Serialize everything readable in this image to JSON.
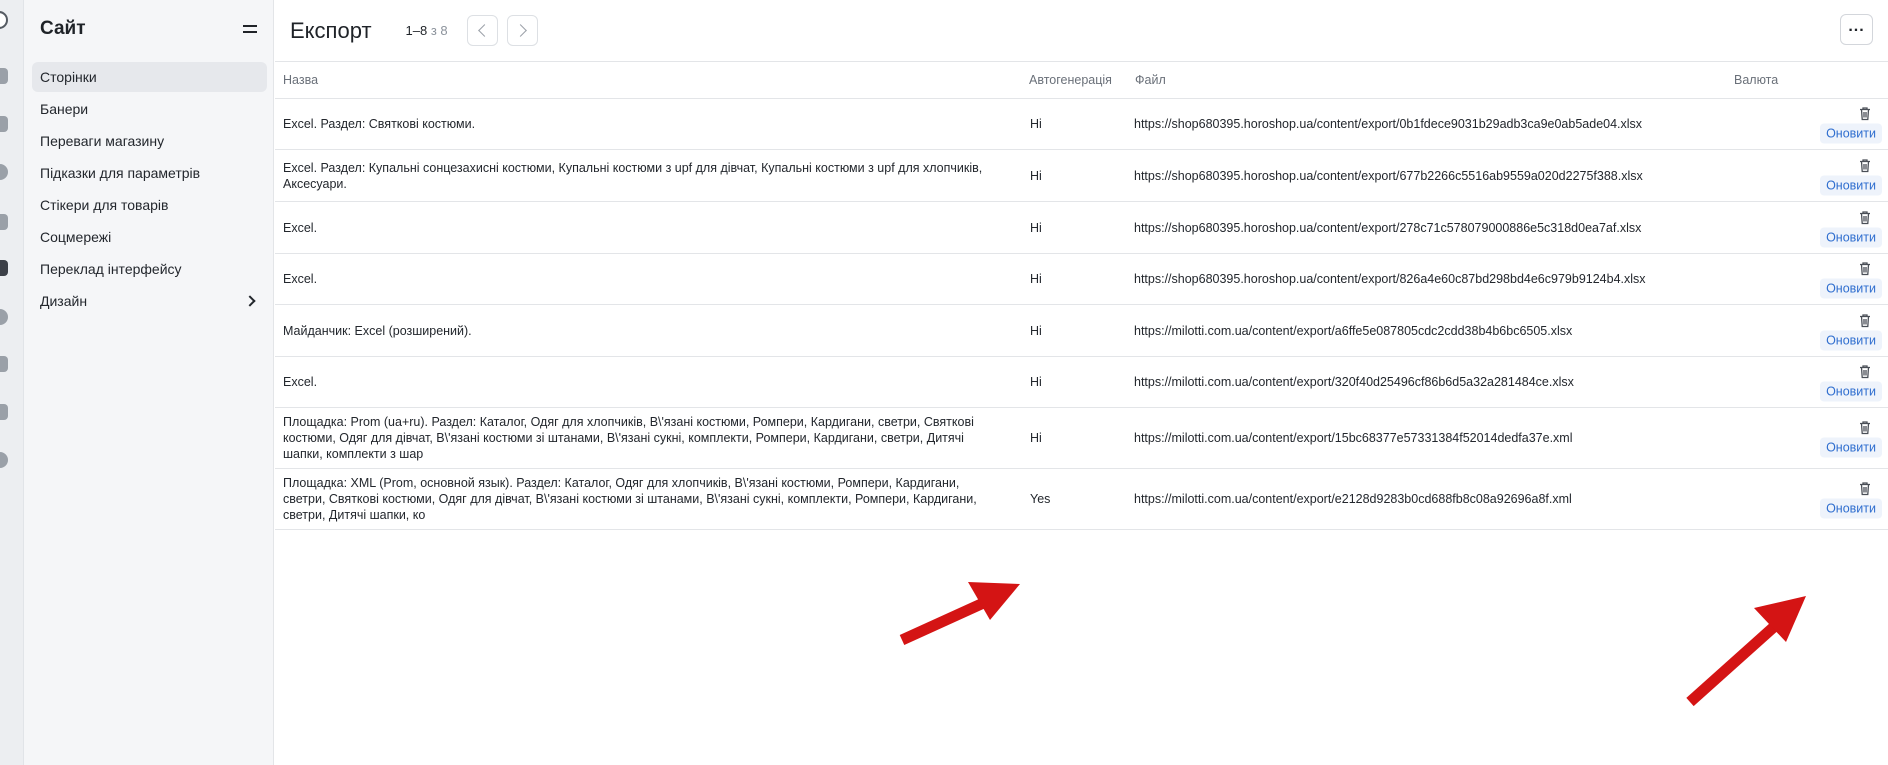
{
  "sidebar": {
    "title": "Сайт",
    "items": [
      {
        "label": "Сторінки",
        "active": true
      },
      {
        "label": "Банери"
      },
      {
        "label": "Переваги магазину"
      },
      {
        "label": "Підказки для параметрів"
      },
      {
        "label": "Стікери для товарів"
      },
      {
        "label": "Соцмережі"
      },
      {
        "label": "Переклад інтерфейсу"
      },
      {
        "label": "Дизайн",
        "has_submenu": true
      }
    ]
  },
  "header": {
    "title": "Експорт",
    "pager_range": "1–8",
    "pager_of": "з 8"
  },
  "table": {
    "columns": [
      "Назва",
      "Автогенерація",
      "Файл",
      "Валюта"
    ],
    "rows": [
      {
        "name": "Excel. Раздел: Святкові костюми.",
        "auto": "Ні",
        "file": "https://shop680395.horoshop.ua/content/export/0b1fdece9031b29adb3ca9e0ab5ade04.xlsx",
        "action": "Оновити"
      },
      {
        "name": "Excel. Раздел: Купальні сонцезахисні костюми, Купальні костюми з upf для дівчат, Купальні костюми з upf для хлопчиків, Аксесуари.",
        "auto": "Ні",
        "file": "https://shop680395.horoshop.ua/content/export/677b2266c5516ab9559a020d2275f388.xlsx",
        "action": "Оновити"
      },
      {
        "name": "Excel.",
        "auto": "Ні",
        "file": "https://shop680395.horoshop.ua/content/export/278c71c578079000886e5c318d0ea7af.xlsx",
        "action": "Оновити"
      },
      {
        "name": "Excel.",
        "auto": "Ні",
        "file": "https://shop680395.horoshop.ua/content/export/826a4e60c87bd298bd4e6c979b9124b4.xlsx",
        "action": "Оновити"
      },
      {
        "name": "Майданчик: Excel (розширений).",
        "auto": "Ні",
        "file": "https://milotti.com.ua/content/export/a6ffe5e087805cdc2cdd38b4b6bc6505.xlsx",
        "action": "Оновити"
      },
      {
        "name": "Excel.",
        "auto": "Ні",
        "file": "https://milotti.com.ua/content/export/320f40d25496cf86b6d5a32a281484ce.xlsx",
        "action": "Оновити"
      },
      {
        "name": "Площадка: Prom (ua+ru). Раздел: Каталог, Одяг для хлопчиків, В\\'язані костюми, Ромпери, Кардигани, светри, Святкові костюми, Одяг для дівчат, В\\'язані костюми зі штанами, В\\'язані сукні, комплекти, Ромпери, Кардигани, светри, Дитячі шапки, комплекти з шар",
        "auto": "Ні",
        "file": "https://milotti.com.ua/content/export/15bc68377e57331384f52014dedfa37e.xml",
        "action": "Оновити"
      },
      {
        "name": "Площадка: XML (Prom, основной язык). Раздел: Каталог, Одяг для хлопчиків, В\\'язані костюми, Ромпери, Кардигани, светри, Святкові костюми, Одяг для дівчат, В\\'язані костюми зі штанами, В\\'язані сукні, комплекти, Ромпери, Кардигани, светри, Дитячі шапки, ко",
        "auto": "Yes",
        "file": "https://milotti.com.ua/content/export/e2128d9283b0cd688fb8c08a92696a8f.xml",
        "action": "Оновити"
      }
    ]
  },
  "colors": {
    "accent": "#2f6ecf",
    "annotation_arrow": "#d41414",
    "sidebar_bg": "#f5f6f8"
  },
  "icons": [
    "collapse-icon",
    "chevron-left-icon",
    "chevron-right-icon",
    "more-icon",
    "trash-icon"
  ]
}
